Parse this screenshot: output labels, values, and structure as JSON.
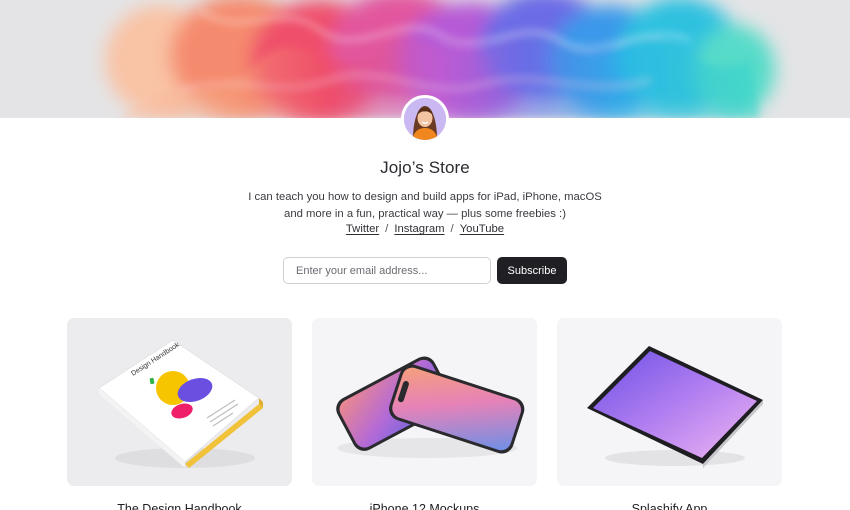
{
  "banner": {
    "colors": [
      "#f7a07a",
      "#ef4f6a",
      "#c45cd1",
      "#6a6de6",
      "#2bb6e8",
      "#38d6c8"
    ]
  },
  "profile": {
    "avatar_icon": "avatar-photo"
  },
  "store": {
    "title": "Jojo’s Store",
    "bio_line1": "I can teach you how to design and build apps for iPad, iPhone, macOS",
    "bio_line2": "and more in a fun, practical way — plus some freebies :)"
  },
  "links": {
    "twitter": "Twitter",
    "instagram": "Instagram",
    "youtube": "YouTube",
    "separator": "/"
  },
  "subscribe": {
    "placeholder": "Enter your email address...",
    "button_label": "Subscribe"
  },
  "products": [
    {
      "title": "The Design Handbook",
      "icon": "book-icon"
    },
    {
      "title": "iPhone 12 Mockups",
      "icon": "phone-icon"
    },
    {
      "title": "Splashify App",
      "icon": "tablet-icon"
    }
  ],
  "book": {
    "cover_title": "Design Handbook"
  }
}
